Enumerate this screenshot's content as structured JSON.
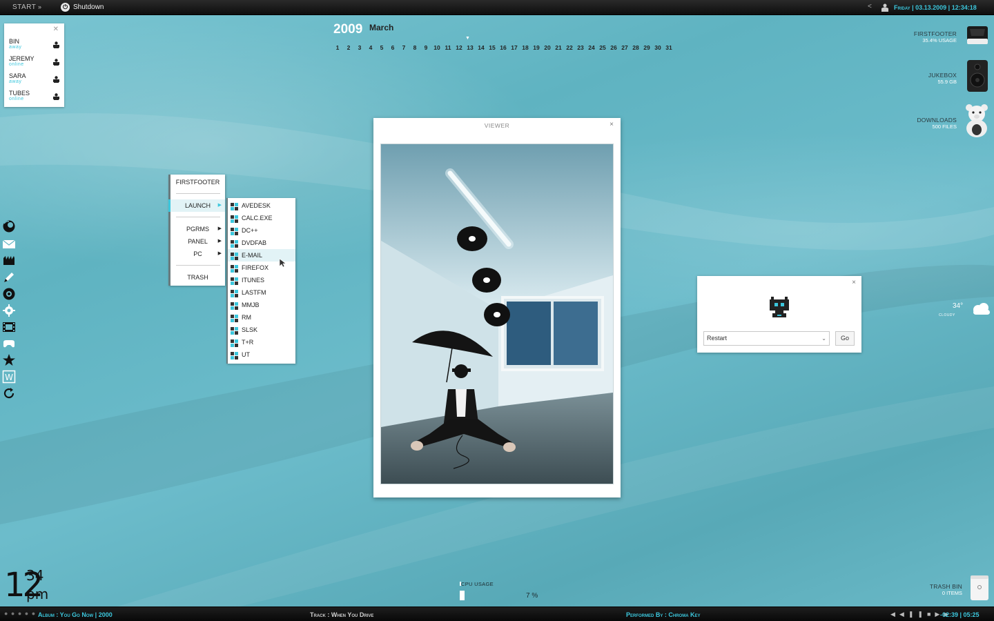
{
  "topbar": {
    "start_label": "START",
    "start_arrow": "»",
    "shutdown_label": "Shutdown",
    "back_glyph": "<",
    "datetime": "Friday | 03.13.2009 | 12:34:18"
  },
  "contacts": [
    {
      "name": "BIN",
      "status": "away"
    },
    {
      "name": "JEREMY",
      "status": "online"
    },
    {
      "name": "SARA",
      "status": "away"
    },
    {
      "name": "TUBES",
      "status": "online"
    }
  ],
  "calendar": {
    "year": "2009",
    "month": "March",
    "days": [
      "1",
      "2",
      "3",
      "4",
      "5",
      "6",
      "7",
      "8",
      "9",
      "10",
      "11",
      "12",
      "13",
      "14",
      "15",
      "16",
      "17",
      "18",
      "19",
      "20",
      "21",
      "22",
      "23",
      "24",
      "25",
      "26",
      "27",
      "28",
      "29",
      "30",
      "31"
    ],
    "today": "13"
  },
  "drives": [
    {
      "name": "FIRSTFOOTER",
      "info": "35.4% USAGE"
    },
    {
      "name": "JUKEBOX",
      "info": "55.9 GB"
    },
    {
      "name": "DOWNLOADS",
      "info": "500 FILES"
    }
  ],
  "menu_main": {
    "items": [
      "FIRSTFOOTER",
      "LAUNCH",
      "PGRMS",
      "PANEL",
      "PC",
      "TRASH"
    ],
    "active": "LAUNCH"
  },
  "menu_launch": {
    "items": [
      "AVEDESK",
      "CALC.EXE",
      "DC++",
      "DVDFAB",
      "E-MAIL",
      "FIREFOX",
      "ITUNES",
      "LASTFM",
      "MMJB",
      "RM",
      "SLSK",
      "T+R",
      "UT"
    ],
    "hover": "E-MAIL"
  },
  "viewer": {
    "title": "VIEWER",
    "close_glyph": "×"
  },
  "dialog": {
    "selected": "Restart",
    "go_label": "Go",
    "close_glyph": "×"
  },
  "weather": {
    "temp": "34°",
    "condition": "cloudy"
  },
  "clock": {
    "hour": "12",
    "minute": "34",
    "ampm": "pm"
  },
  "cpu": {
    "label": "CPU USAGE",
    "value": "7 %",
    "percent": 7
  },
  "trash": {
    "name": "TRASH BIN",
    "info": "0 ITEMS"
  },
  "player": {
    "dots": "● ● ● ● ●",
    "album_label": "Album :",
    "album_value": "You Go Now | 2000",
    "track_label": "Track :",
    "track_value": "When You Drive",
    "performer_label": "Performed By :",
    "performer_value": "Chroma Key",
    "time": "-02:39 | 05:25"
  },
  "colors": {
    "accent": "#3cc7dd",
    "wallpaper": "#5fb3c1"
  }
}
